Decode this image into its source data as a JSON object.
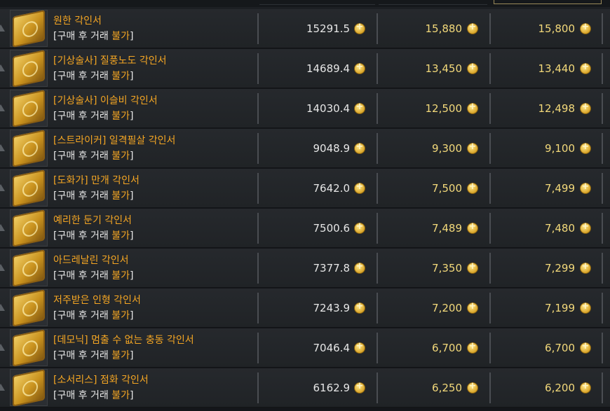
{
  "note_prefix": "[구매 후 거래 ",
  "note_bad": "불가",
  "note_suffix": "]",
  "items": [
    {
      "name": "원한 각인서",
      "avg": "15291.5",
      "recent": "15,880",
      "lowest": "15,800"
    },
    {
      "name": "[기상술사] 질풍노도 각인서",
      "avg": "14689.4",
      "recent": "13,450",
      "lowest": "13,440"
    },
    {
      "name": "[기상술사] 이슬비 각인서",
      "avg": "14030.4",
      "recent": "12,500",
      "lowest": "12,498"
    },
    {
      "name": "[스트라이커] 일격필살 각인서",
      "avg": "9048.9",
      "recent": "9,300",
      "lowest": "9,100"
    },
    {
      "name": "[도화가] 만개 각인서",
      "avg": "7642.0",
      "recent": "7,500",
      "lowest": "7,499"
    },
    {
      "name": "예리한 둔기 각인서",
      "avg": "7500.6",
      "recent": "7,489",
      "lowest": "7,480"
    },
    {
      "name": "아드레날린 각인서",
      "avg": "7377.8",
      "recent": "7,350",
      "lowest": "7,299"
    },
    {
      "name": "저주받은 인형 각인서",
      "avg": "7243.9",
      "recent": "7,200",
      "lowest": "7,199"
    },
    {
      "name": "[데모닉] 멈출 수 없는 충동 각인서",
      "avg": "7046.4",
      "recent": "6,700",
      "lowest": "6,700"
    },
    {
      "name": "[소서리스] 점화 각인서",
      "avg": "6162.9",
      "recent": "6,250",
      "lowest": "6,200"
    }
  ]
}
